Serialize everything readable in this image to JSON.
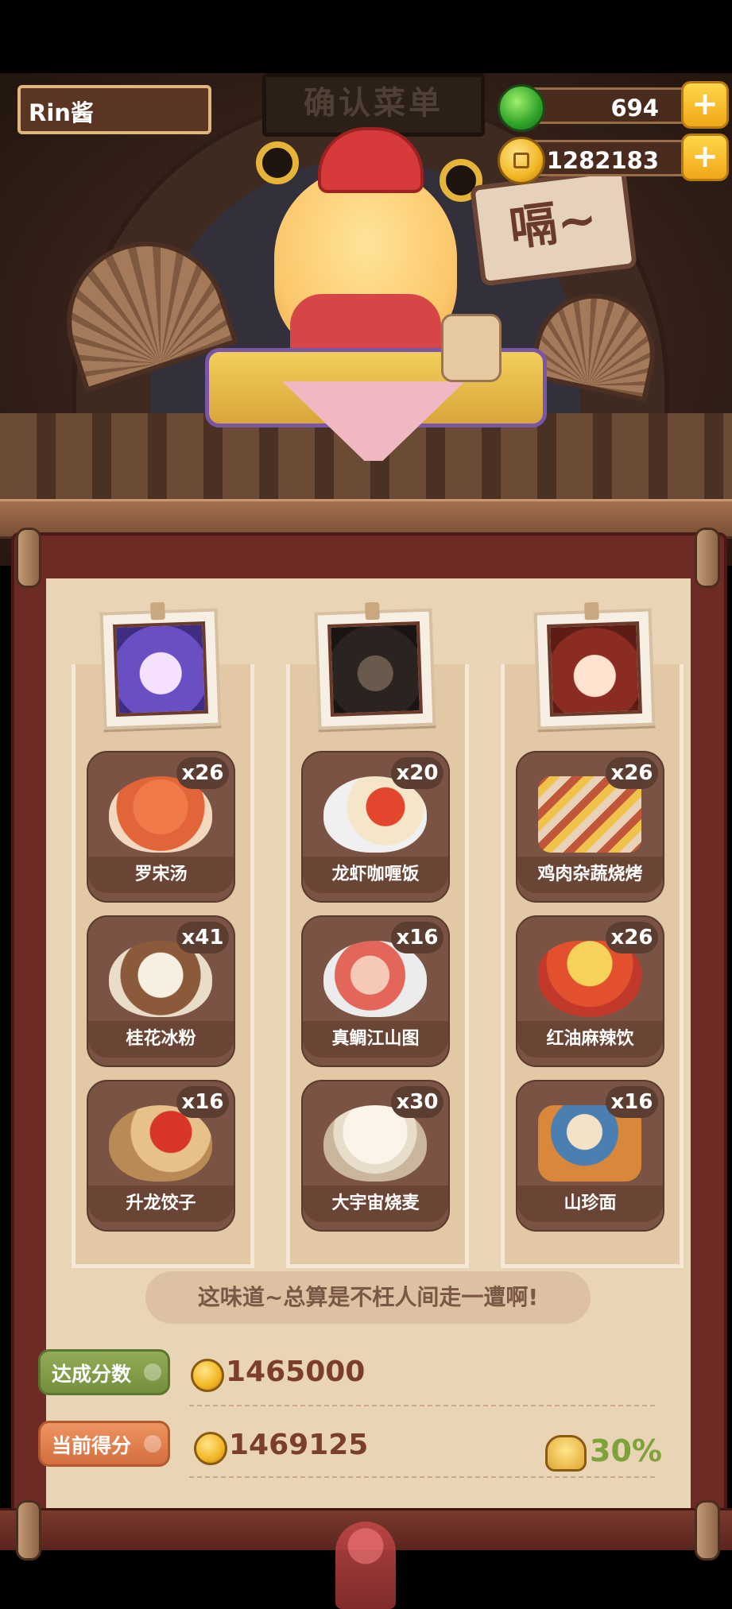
{
  "hud": {
    "player_name": "Rin酱",
    "jade": "694",
    "coins": "1282183",
    "plus_label": "+"
  },
  "scene": {
    "sign_text": "确认菜单",
    "speech_text": "嗝~"
  },
  "columns": [
    {
      "dishes": [
        {
          "name": "罗宋汤",
          "count": "x26"
        },
        {
          "name": "桂花冰粉",
          "count": "x41"
        },
        {
          "name": "升龙饺子",
          "count": "x16"
        }
      ]
    },
    {
      "dishes": [
        {
          "name": "龙虾咖喱饭",
          "count": "x20"
        },
        {
          "name": "真鲷江山图",
          "count": "x16"
        },
        {
          "name": "大宇宙烧麦",
          "count": "x30"
        }
      ]
    },
    {
      "dishes": [
        {
          "name": "鸡肉杂蔬烧烤",
          "count": "x26"
        },
        {
          "name": "红油麻辣饮",
          "count": "x26"
        },
        {
          "name": "山珍面",
          "count": "x16"
        }
      ]
    }
  ],
  "quote": "这味道~总算是不枉人间走一遭啊!",
  "scores": {
    "target_label": "达成分数",
    "target_value": "1465000",
    "current_label": "当前得分",
    "current_value": "1469125",
    "bonus_percent": "30%"
  },
  "colors": {
    "target_tag": "#7fa040",
    "current_tag": "#e07f4e",
    "bonus_text": "#7fa23a",
    "score_text": "#7a3e2a"
  }
}
